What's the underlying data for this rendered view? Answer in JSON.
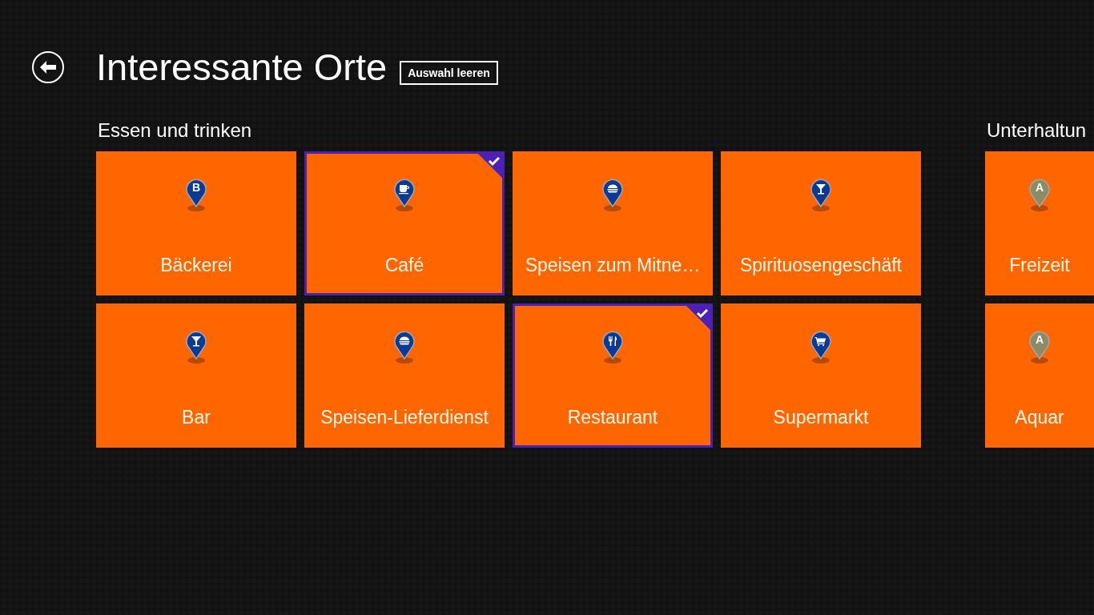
{
  "page": {
    "title": "Interessante Orte",
    "clear_button": "Auswahl leeren"
  },
  "groups": [
    {
      "heading": "Essen und trinken",
      "tiles": [
        {
          "label": "Bäckerei",
          "kind": "letter",
          "letter": "B",
          "color": "#0a3a94",
          "selected": false
        },
        {
          "label": "Bar",
          "kind": "glass",
          "color": "#0a3a94",
          "selected": false
        },
        {
          "label": "Café",
          "kind": "cup",
          "color": "#0a3a94",
          "selected": true
        },
        {
          "label": "Speisen-Lieferdienst",
          "kind": "burger",
          "color": "#0a3a94",
          "selected": false
        },
        {
          "label": "Speisen zum Mitne…",
          "kind": "burger",
          "color": "#0a3a94",
          "selected": false
        },
        {
          "label": "Restaurant",
          "kind": "cutlery",
          "color": "#0a3a94",
          "selected": true
        },
        {
          "label": "Spirituosengeschäft",
          "kind": "glass",
          "color": "#0a3a94",
          "selected": false
        },
        {
          "label": "Supermarkt",
          "kind": "cart",
          "color": "#0a3a94",
          "selected": false
        }
      ]
    },
    {
      "heading": "Unterhaltun",
      "tiles": [
        {
          "label": "Freizeit",
          "kind": "letter",
          "letter": "A",
          "color": "#8c8c64",
          "selected": false
        },
        {
          "label": "Aquar",
          "kind": "letter",
          "letter": "A",
          "color": "#8c8c64",
          "selected": false
        }
      ]
    }
  ]
}
